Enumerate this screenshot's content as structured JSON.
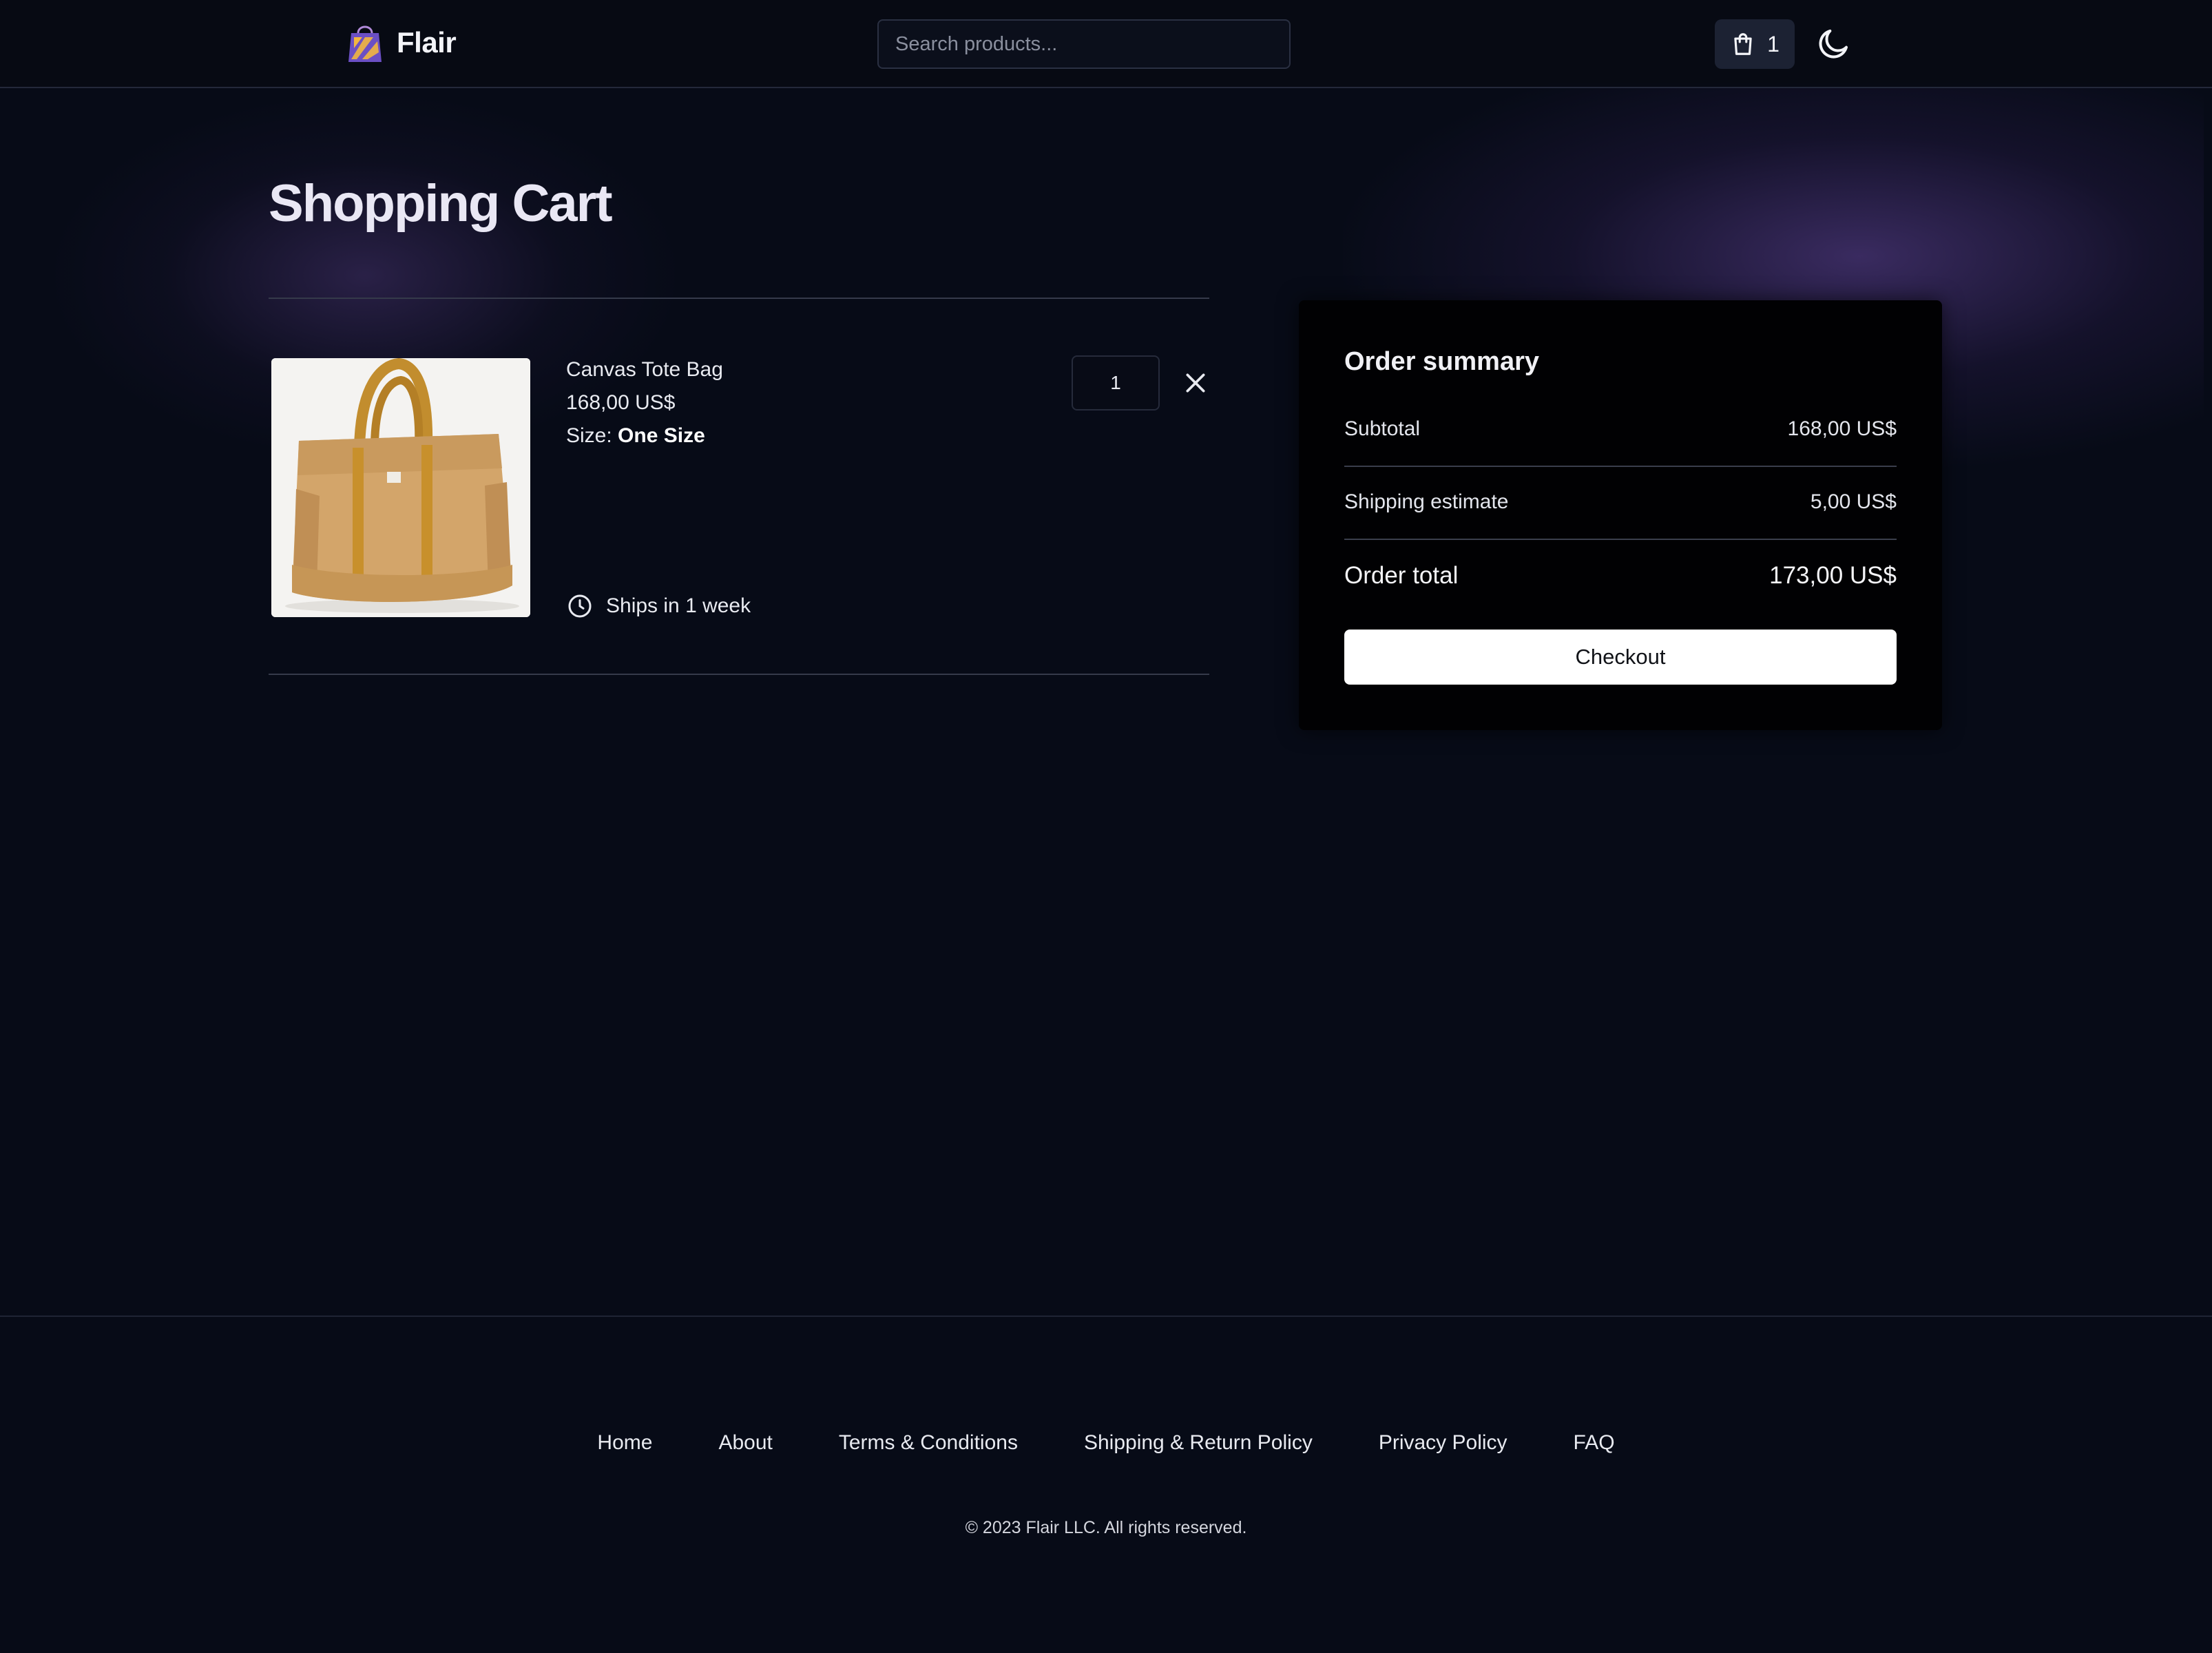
{
  "header": {
    "brand": "Flair",
    "search_placeholder": "Search products...",
    "cart_count": "1"
  },
  "page_title": "Shopping Cart",
  "cart": {
    "items": [
      {
        "name": "Canvas Tote Bag",
        "price": "168,00 US$",
        "size_label": "Size:",
        "size_value": "One Size",
        "shipping": "Ships in 1 week",
        "quantity": "1"
      }
    ]
  },
  "summary": {
    "title": "Order summary",
    "subtotal_label": "Subtotal",
    "subtotal_value": "168,00 US$",
    "shipping_label": "Shipping estimate",
    "shipping_value": "5,00 US$",
    "total_label": "Order total",
    "total_value": "173,00 US$",
    "checkout_label": "Checkout"
  },
  "footer": {
    "links": [
      "Home",
      "About",
      "Terms & Conditions",
      "Shipping & Return Policy",
      "Privacy Policy",
      "FAQ"
    ],
    "copyright": "© 2023 Flair LLC. All rights reserved."
  },
  "colors": {
    "background": "#070b17",
    "accent_glow": "#553c87",
    "checkout_button": "#ffffff",
    "summary_panel": "#010103"
  },
  "icons": [
    "shopping-bag-logo-icon",
    "shopping-bag-icon",
    "moon-icon",
    "clock-icon",
    "close-icon"
  ]
}
